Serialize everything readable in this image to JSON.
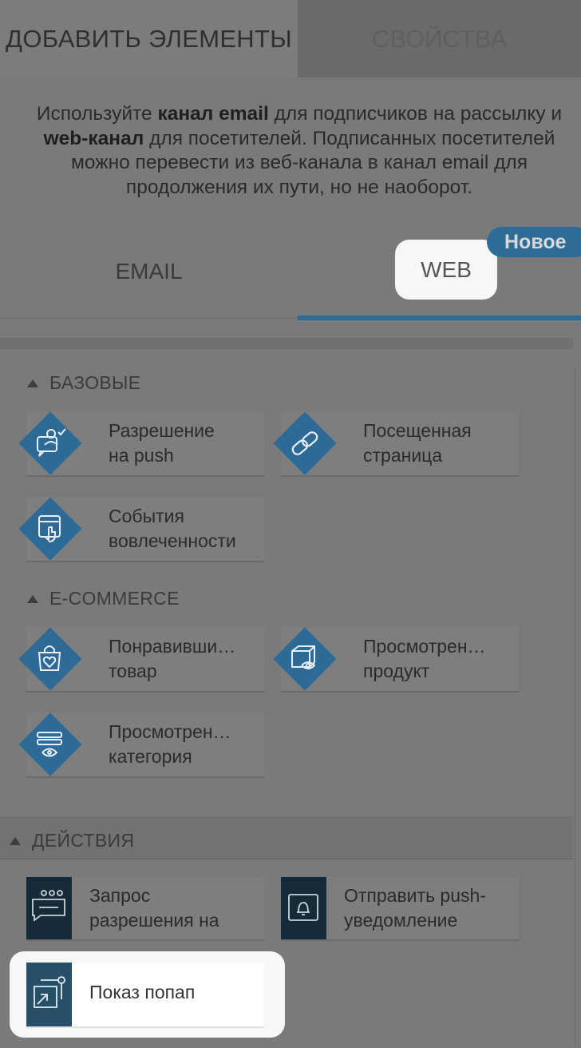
{
  "tabs": {
    "add_elements": "ДОБАВИТЬ ЭЛЕМЕНТЫ",
    "properties": "СВОЙСТВА"
  },
  "hint": {
    "p1": "Используйте ",
    "b1": "канал email",
    "p2": " для подписчиков на рассылку и ",
    "b2": "web-канал",
    "p3": " для посетителей. Подписанных посетителей можно перевести из веб-канала в канал email для продолжения их пути, но не наоборот."
  },
  "channels": {
    "email": "EMAIL",
    "web": "WEB",
    "new_badge": "Новое"
  },
  "sections": {
    "basic": {
      "title": "БАЗОВЫЕ",
      "items": [
        {
          "line1": "Разрешение",
          "line2": "на push",
          "icon": "push-permission-icon"
        },
        {
          "line1": "Посещенная",
          "line2": "страница",
          "icon": "link-icon"
        },
        {
          "line1": "События",
          "line2": "вовлеченности",
          "icon": "engagement-icon"
        }
      ]
    },
    "ecommerce": {
      "title": "E-COMMERCE",
      "items": [
        {
          "line1": "Понравивши…",
          "line2": "товар",
          "icon": "bag-heart-icon"
        },
        {
          "line1": "Просмотрен…",
          "line2": "продукт",
          "icon": "box-eye-icon"
        },
        {
          "line1": "Просмотрен…",
          "line2": "категория",
          "icon": "list-eye-icon"
        }
      ]
    },
    "actions": {
      "title": "ДЕЙСТВИЯ",
      "items": [
        {
          "line1": "Запрос",
          "line2": "разрешения на",
          "icon": "chat-request-icon"
        },
        {
          "line1": "Отправить push-",
          "line2": "уведомление",
          "icon": "bell-window-icon"
        },
        {
          "line1": "Показ попап",
          "line2": "",
          "icon": "popup-icon"
        }
      ]
    }
  },
  "colors": {
    "accent": "#2d6995",
    "action_icon_bg": "#162a38",
    "popup_icon_bg": "#275068"
  }
}
